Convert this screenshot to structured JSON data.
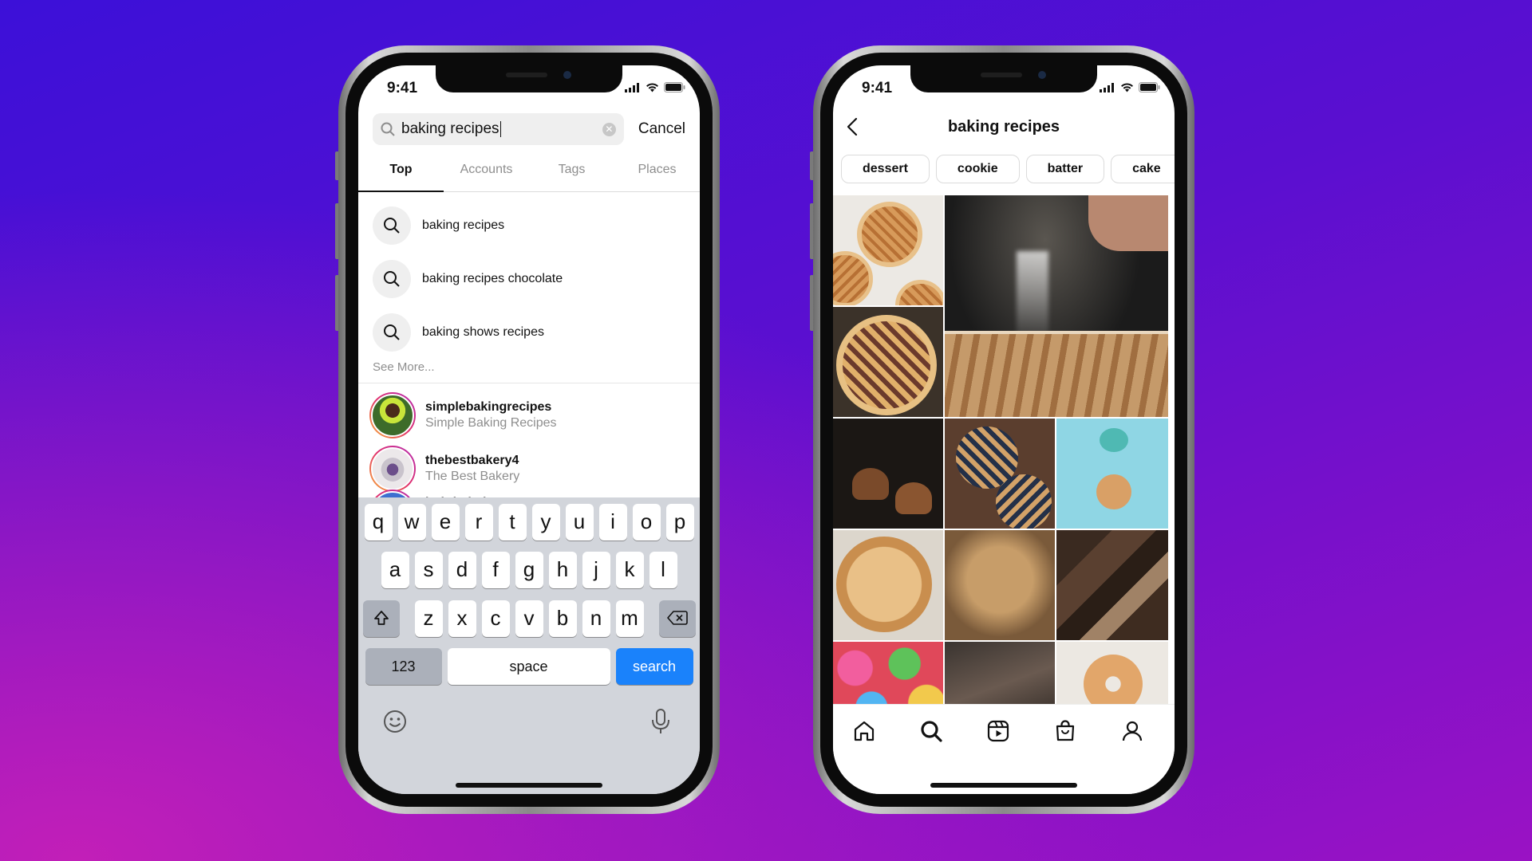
{
  "status": {
    "time": "9:41"
  },
  "left_phone": {
    "search": {
      "query": "baking recipes",
      "cancel_label": "Cancel"
    },
    "tabs": [
      "Top",
      "Accounts",
      "Tags",
      "Places"
    ],
    "suggestions": [
      "baking recipes",
      "baking recipes chocolate",
      "baking shows recipes"
    ],
    "see_more": "See More...",
    "accounts": [
      {
        "username": "simplebakingrecipes",
        "name": "Simple Baking Recipes"
      },
      {
        "username": "thebestbakery4",
        "name": "The Best Bakery"
      },
      {
        "username": "bobthebakery",
        "name": ""
      }
    ],
    "keyboard": {
      "row1": [
        "q",
        "w",
        "e",
        "r",
        "t",
        "y",
        "u",
        "i",
        "o",
        "p"
      ],
      "row2": [
        "a",
        "s",
        "d",
        "f",
        "g",
        "h",
        "j",
        "k",
        "l"
      ],
      "row3": [
        "z",
        "x",
        "c",
        "v",
        "b",
        "n",
        "m"
      ],
      "numbers_label": "123",
      "space_label": "space",
      "search_label": "search"
    }
  },
  "right_phone": {
    "title": "baking recipes",
    "chips": [
      "dessert",
      "cookie",
      "batter",
      "cake"
    ],
    "tabbar_icons": [
      "home-icon",
      "search-icon",
      "reels-icon",
      "shop-icon",
      "profile-icon"
    ]
  },
  "colors": {
    "accent_blue": "#1a82fb",
    "keyboard_bg": "#d2d5db"
  }
}
